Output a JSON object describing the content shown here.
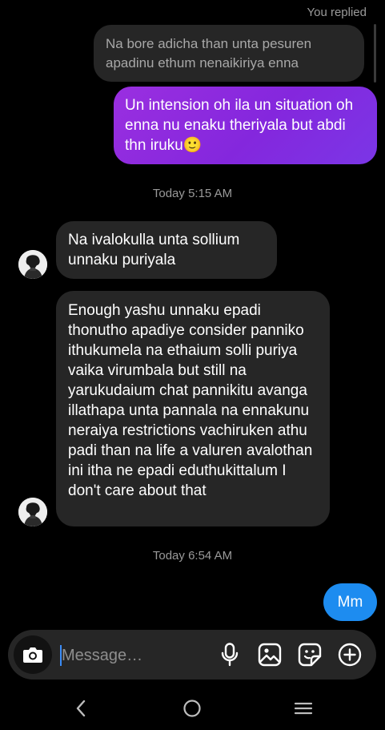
{
  "thread": {
    "replied_label": "You replied",
    "quoted_text": "Na bore adicha than unta pesuren apadinu ethum nenaikiriya enna",
    "sent_purple_text": "Un intension oh ila un situation oh enna nu enaku theriyala but abdi thn iruku",
    "sent_purple_emoji": "🙂",
    "timestamp_1": "Today 5:15 AM",
    "received_1": "Na ivalokulla unta sollium unnaku puriyala",
    "received_2": "Enough yashu unnaku epadi thonutho apadiye consider panniko ithukumela na ethaium solli puriya vaika virumbala but still na yarukudaium chat pannikitu avanga illathapa unta pannala na ennakunu neraiya restrictions vachiruken athu padi than na life a valuren avalothan ini itha ne epadi eduthukittalum I don't care about that",
    "timestamp_2": "Today 6:54 AM",
    "sent_blue_text": "Mm"
  },
  "composer": {
    "placeholder": "Message…",
    "icons": [
      "camera-icon",
      "microphone-icon",
      "gallery-icon",
      "sticker-icon",
      "add-icon"
    ]
  },
  "navbar": {
    "icons": [
      "back-icon",
      "home-icon",
      "recents-icon"
    ]
  },
  "colors": {
    "background": "#000000",
    "received_bubble": "#262626",
    "sent_gradient_start": "#9a2fe0",
    "sent_gradient_end": "#7b36e6",
    "sent_blue": "#1d8cf0",
    "muted_text": "#9a9a9a"
  }
}
